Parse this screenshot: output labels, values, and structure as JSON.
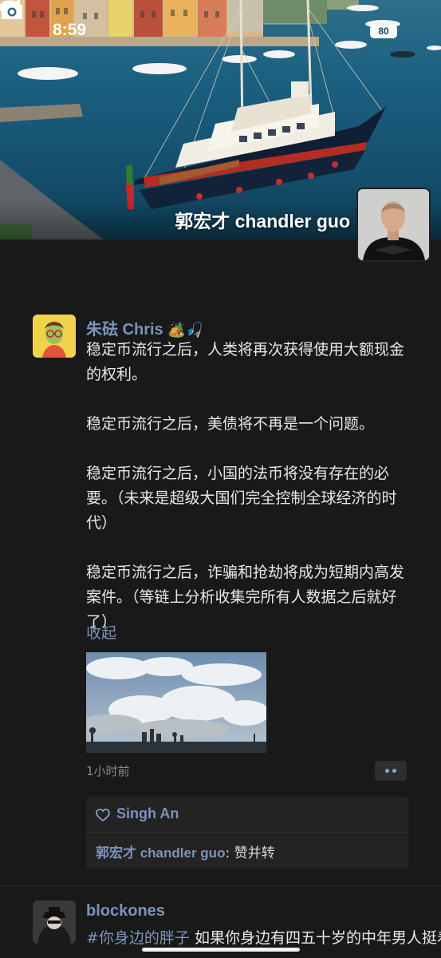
{
  "status_bar": {
    "time": "8:59",
    "battery": "80"
  },
  "profile": {
    "name": "郭宏才 chandler guo",
    "avatar_icon": "person-avatar",
    "camera_icon": "camera-icon"
  },
  "posts": [
    {
      "author": "朱砝 Chris",
      "author_emojis": "🏕️🎣",
      "paragraphs": [
        "稳定币流行之后，人类将再次获得使用大额现金的权利。",
        "稳定币流行之后，美债将不再是一个问题。",
        "稳定币流行之后，小国的法币将没有存在的必要。（未来是超级大国们完全控制全球经济的时代）",
        "稳定币流行之后，诈骗和抢劫将成为短期内高发案件。（等链上分析收集完所有人数据之后就好了）"
      ],
      "collapse_label": "收起",
      "time": "1小时前",
      "liker": "Singh An",
      "comment": {
        "author": "郭宏才 chandler guo",
        "separator": ": ",
        "text": "赞并转"
      }
    },
    {
      "author": "blockones",
      "hashtag": "#你身边的胖子",
      "text": " 如果你身边有四五十岁的中年男人挺着个大肚子，我建议如果你有选"
    }
  ],
  "colors": {
    "background": "#191919",
    "link": "#7d93b8",
    "text": "#e8e8e8"
  }
}
